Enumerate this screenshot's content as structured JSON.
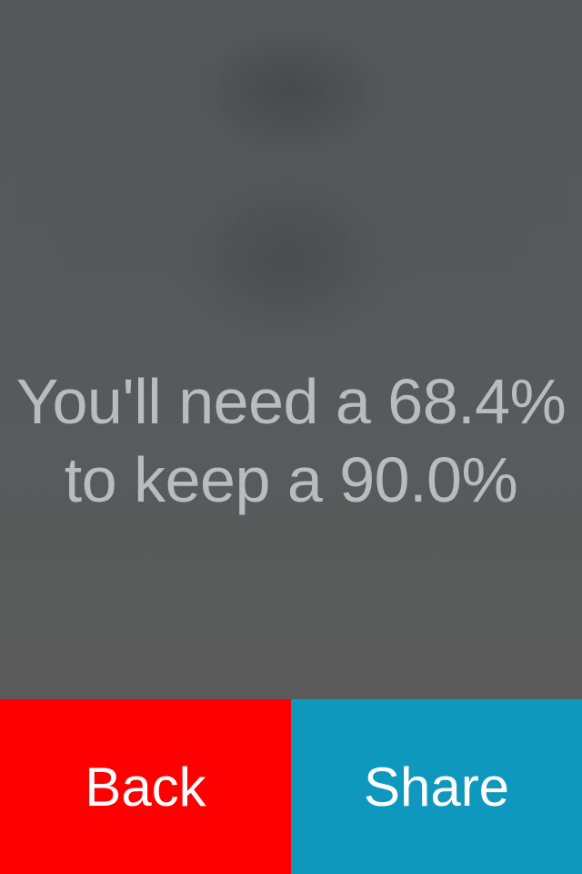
{
  "result": {
    "line1": "You'll need a 68.4%",
    "line2": "to keep a 90.0%"
  },
  "actions": {
    "back_label": "Back",
    "share_label": "Share"
  },
  "colors": {
    "background": "#585a5b",
    "result_text": "#b9bcbd",
    "back_button": "#ff0000",
    "share_button": "#0e98be",
    "button_text": "#ffffff"
  }
}
